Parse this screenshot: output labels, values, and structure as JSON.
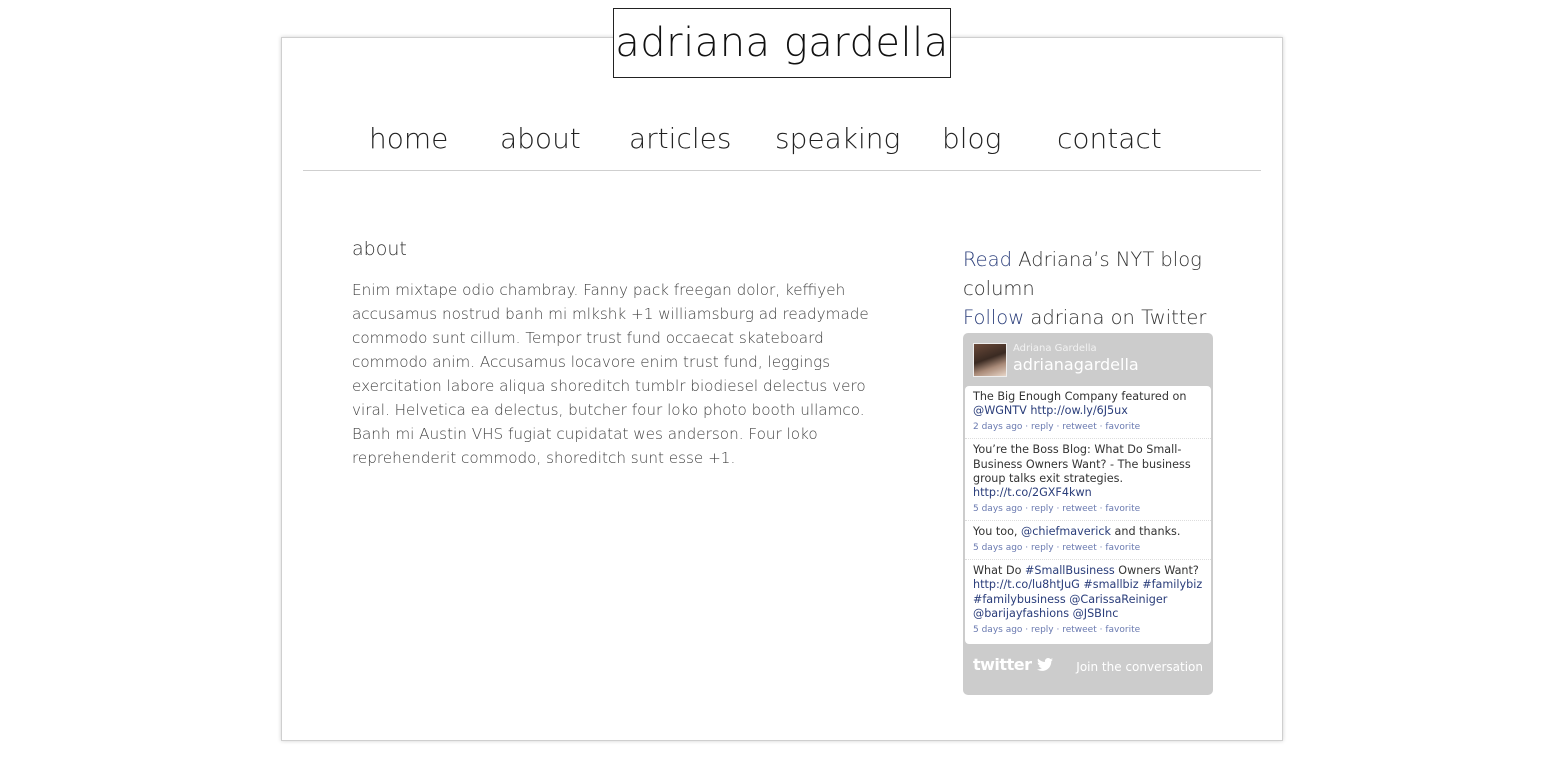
{
  "site": {
    "logo_text": "adriana gardella"
  },
  "nav": {
    "items": [
      {
        "label": "home"
      },
      {
        "label": "about"
      },
      {
        "label": "articles"
      },
      {
        "label": "speaking"
      },
      {
        "label": "blog"
      },
      {
        "label": "contact"
      }
    ]
  },
  "main": {
    "title": "about",
    "body": "Enim mixtape odio chambray. Fanny pack freegan dolor, keffiyeh accusamus nostrud banh mi mlkshk +1 williamsburg ad readymade commodo sunt cillum. Tempor trust fund occaecat skateboard commodo anim. Accusamus locavore enim trust fund, leggings exercitation labore aliqua shoreditch tumblr biodiesel delectus vero viral. Helvetica ea delectus, butcher four loko photo booth ullamco. Banh mi Austin VHS fugiat cupidatat wes anderson. Four loko reprehenderit commodo, shoreditch sunt esse +1."
  },
  "sidebar": {
    "nyt_link": "Read",
    "nyt_text": " Adriana’s NYT blog column",
    "twitter_link": "Follow",
    "twitter_text": " adriana on Twitter"
  },
  "twitter_widget": {
    "full_name": "Adriana Gardella",
    "handle": "adrianagardella",
    "tweets": [
      {
        "text_before": "The Big Enough Company featured on ",
        "link1": "@WGNTV",
        "mid": " ",
        "link2": "http://ow.ly/6J5ux",
        "after": "",
        "time": "2 days ago"
      },
      {
        "text_before": "You’re the Boss Blog: What Do Small-Business Owners Want? - The business group talks exit strategies. ",
        "link1": "http://t.co/2GXF4kwn",
        "mid": "",
        "link2": "",
        "after": "",
        "time": "5 days ago"
      },
      {
        "text_before": "You too, ",
        "link1": "@chiefmaverick",
        "mid": " and thanks.",
        "link2": "",
        "after": "",
        "time": "5 days ago"
      },
      {
        "text_before": "What Do ",
        "link1": "#SmallBusiness",
        "mid": " Owners Want? ",
        "link2": "http://t.co/lu8htJuG #smallbiz #familybiz #familybusiness @CarissaReiniger @barijayfashions @JSBInc",
        "after": "",
        "time": "5 days ago"
      }
    ],
    "actions": {
      "reply": "reply",
      "retweet": "retweet",
      "favorite": "favorite",
      "separator": " · "
    },
    "footer_logo": "twitter",
    "footer_join": "Join the conversation"
  },
  "colors": {
    "link_blue": "#2a3d7a",
    "widget_gray": "#cccccc"
  }
}
